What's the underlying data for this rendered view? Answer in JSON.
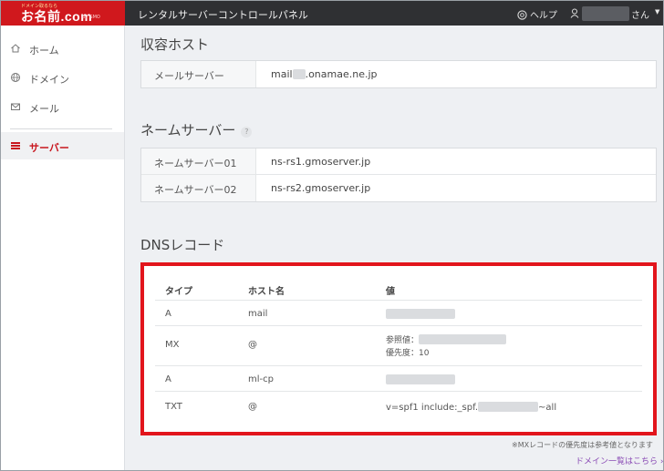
{
  "topbar": {
    "logo_tag": "ドメイン取るなら",
    "logo_text": "お名前.com",
    "logo_sub": "by GMO",
    "app_title": "レンタルサーバーコントロールパネル",
    "help_label": "ヘルプ",
    "user_suffix": "さん",
    "user_caret": "▼"
  },
  "sidebar": {
    "items": [
      {
        "label": "ホーム",
        "icon": "home-icon"
      },
      {
        "label": "ドメイン",
        "icon": "globe-icon"
      },
      {
        "label": "メール",
        "icon": "mail-icon"
      },
      {
        "label": "サーバー",
        "icon": "server-icon",
        "active": true
      }
    ]
  },
  "accommodation": {
    "title": "収容ホスト",
    "rows": [
      {
        "key": "メールサーバー",
        "value_prefix": "mail",
        "value_suffix": ".onamae.ne.jp"
      }
    ]
  },
  "nameservers": {
    "title": "ネームサーバー",
    "help_mark": "?",
    "rows": [
      {
        "key": "ネームサーバー01",
        "value": "ns-rs1.gmoserver.jp"
      },
      {
        "key": "ネームサーバー02",
        "value": "ns-rs2.gmoserver.jp"
      }
    ]
  },
  "dns": {
    "title": "DNSレコード",
    "headers": {
      "type": "タイプ",
      "host": "ホスト名",
      "value": "値"
    },
    "rows": [
      {
        "type": "A",
        "host": "mail"
      },
      {
        "type": "MX",
        "host": "@",
        "ref_label": "参照値：",
        "priority_label": "優先度：10"
      },
      {
        "type": "A",
        "host": "ml-cp"
      },
      {
        "type": "TXT",
        "host": "@",
        "value_prefix": "v=spf1 include:_spf.",
        "value_suffix": "~all"
      }
    ]
  },
  "footnote": "※MXレコードの優先度は参考値となります",
  "domain_list_link": "ドメイン一覧はこちら ›",
  "colors": {
    "brand_red": "#d0181d",
    "highlight_red": "#e2151c",
    "topbar": "#2f3033",
    "link_purple": "#8a4bb5"
  }
}
